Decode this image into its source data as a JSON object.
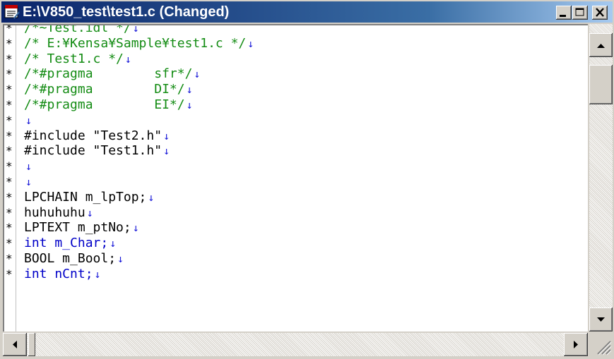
{
  "window": {
    "title": "E:\\V850_test\\test1.c (Changed)",
    "title_bar_color": "#0a246a"
  },
  "editor": {
    "line_marker": "*",
    "eol_marker": "↓",
    "lines": [
      {
        "text": "/*~Test.idl */",
        "color": "green"
      },
      {
        "text": "/* E:¥Kensa¥Sample¥test1.c */",
        "color": "green"
      },
      {
        "text": "/* Test1.c */",
        "color": "green"
      },
      {
        "text": "/*#pragma        sfr*/",
        "color": "green"
      },
      {
        "text": "/*#pragma        DI*/",
        "color": "green"
      },
      {
        "text": "/*#pragma        EI*/",
        "color": "green"
      },
      {
        "text": "",
        "color": "black"
      },
      {
        "text": "#include \"Test2.h\"",
        "color": "black"
      },
      {
        "text": "#include \"Test1.h\"",
        "color": "black"
      },
      {
        "text": "",
        "color": "black"
      },
      {
        "text": "",
        "color": "black"
      },
      {
        "text": "LPCHAIN m_lpTop;",
        "color": "black"
      },
      {
        "text": "huhuhuhu",
        "color": "black"
      },
      {
        "text": "LPTEXT m_ptNo;",
        "color": "black"
      },
      {
        "text": "int m_Char;",
        "color": "blue"
      },
      {
        "text": "BOOL m_Bool;",
        "color": "black"
      },
      {
        "text": "int nCnt;",
        "color": "blue"
      }
    ],
    "colors": {
      "comment": "#148c14",
      "keyword": "#0000c8",
      "eol": "#1a1ad8"
    }
  },
  "icons": {
    "app": "notepad-icon",
    "minimize": "minimize-icon",
    "maximize": "maximize-icon",
    "close": "close-icon"
  }
}
